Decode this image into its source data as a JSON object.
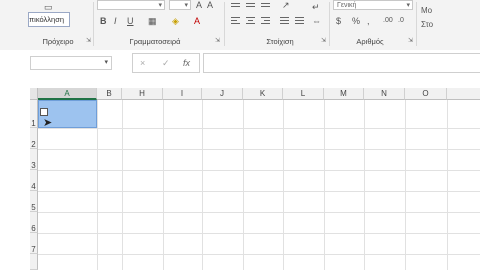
{
  "ribbon": {
    "clipboard": {
      "button_label": "πικόλληση",
      "group_label": "Πρόχειρο"
    },
    "font": {
      "group_label": "Γραμματοσειρά",
      "bold": "B",
      "italic": "I",
      "underline": "U"
    },
    "alignment": {
      "group_label": "Στοίχιση"
    },
    "number": {
      "group_label": "Αριθμός",
      "format_value": "Γενική"
    },
    "styles": {
      "item_1": "Μο",
      "item_2": "Στο"
    }
  },
  "formula_bar": {
    "cancel_symbol": "×",
    "confirm_symbol": "✓",
    "fx_symbol": "fx"
  },
  "sheet": {
    "columns": [
      "A",
      "B",
      "H",
      "I",
      "J",
      "K",
      "L",
      "M",
      "N",
      "O"
    ],
    "rows": [
      "1",
      "2",
      "3",
      "4",
      "5",
      "6",
      "7"
    ],
    "selected_column": "A",
    "selected_cell": "A1"
  }
}
